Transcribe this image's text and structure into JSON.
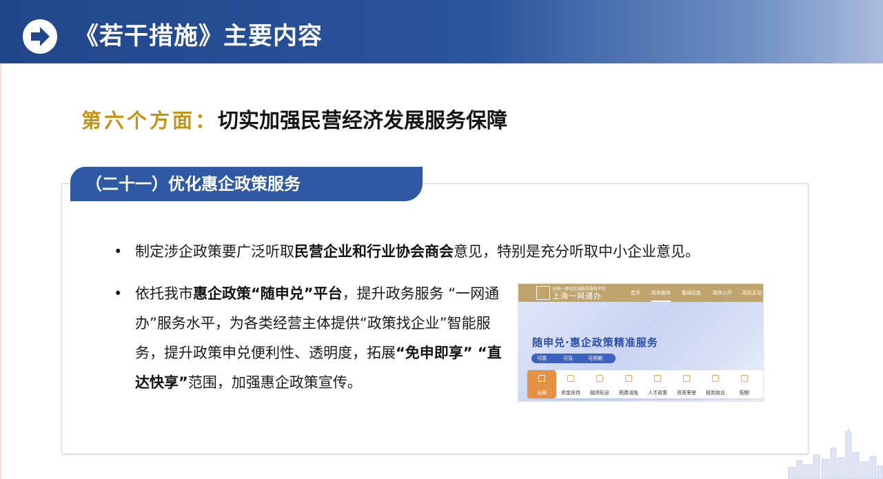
{
  "header": {
    "title": "《若干措施》主要内容"
  },
  "subtitle": {
    "label": "第六个方面：",
    "text": "切实加强民营经济发展服务保障"
  },
  "section": {
    "title": "（二十一）优化惠企政策服务"
  },
  "bullets": {
    "dot": "•",
    "b1": {
      "pre": "制定涉企政策要广泛听取",
      "bold": "民营企业和行业协会商会",
      "post": "意见，特别是充分听取中小企业意见。"
    },
    "b2": {
      "pre": "依托我市",
      "bold1": "惠企政策“随申兑”平台",
      "mid": "，提升政务服务 “一网通办”服务水平，为各类经营主体提供“政策找企业”智能服务，提升政策申兑便利性、透明度，拓展",
      "bold2": "“免申即享” “直达快享”",
      "post": "范围，加强惠企政策宣传。"
    }
  },
  "screenshot": {
    "portal_small": "全国一体化在线政务服务平台",
    "portal": "上海一网通办",
    "nav": [
      "首页",
      "政务服务",
      "要闻动态",
      "政务公开",
      "政民互动"
    ],
    "nav_active_index": 1,
    "banner_title": "随申兑·惠企政策精准服务",
    "tags": [
      "可感",
      "可及",
      "可预期"
    ],
    "categories": [
      "全部",
      "资金扶持",
      "融资贴息",
      "税费减免",
      "人才政策",
      "资质荣誉",
      "稳岗就业",
      "配额"
    ],
    "category_active_index": 0
  },
  "colors": {
    "header": "#2b559c",
    "section_tab": "#2f5aa3",
    "gold_label": "#c39416",
    "active_category": "#e69244"
  }
}
